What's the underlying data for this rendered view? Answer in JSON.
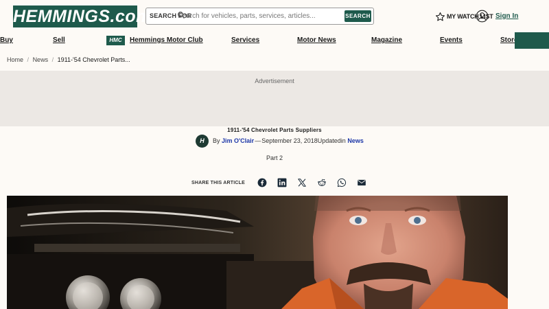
{
  "header": {
    "logo": "HEMMINGS.com",
    "search": {
      "label": "SEARCH FOR",
      "placeholder": "Search for vehicles, parts, services, articles...",
      "button": "SEARCH"
    },
    "watch_list": "MY WATCH LIST",
    "sign_in": "Sign In"
  },
  "nav": {
    "items": [
      "Buy",
      "Sell",
      "Hemmings Motor Club",
      "Services",
      "Motor News",
      "Magazine",
      "Events",
      "Store"
    ],
    "badge": "HMC"
  },
  "breadcrumb": {
    "home": "Home",
    "news": "News",
    "current": "1911-'54 Chevrolet Parts..."
  },
  "ad": {
    "label": "Advertisement"
  },
  "article": {
    "title": "1911-'54 Chevrolet Parts Suppliers",
    "by": "By",
    "author": "Jim O'Clair",
    "dash": "—",
    "date": "September 23, 2018",
    "updated": "Updated",
    "in": "in",
    "category": "News",
    "part": "Part 2",
    "share_label": "SHARE THIS ARTICLE",
    "share_icons": [
      "facebook-icon",
      "linkedin-icon",
      "x-icon",
      "reddit-icon",
      "whatsapp-icon",
      "email-icon"
    ]
  },
  "colors": {
    "brand_green": "#1e5a4c",
    "link_blue": "#1d37a8",
    "background": "#fdfaf6",
    "ad_background": "#ece8e4"
  }
}
